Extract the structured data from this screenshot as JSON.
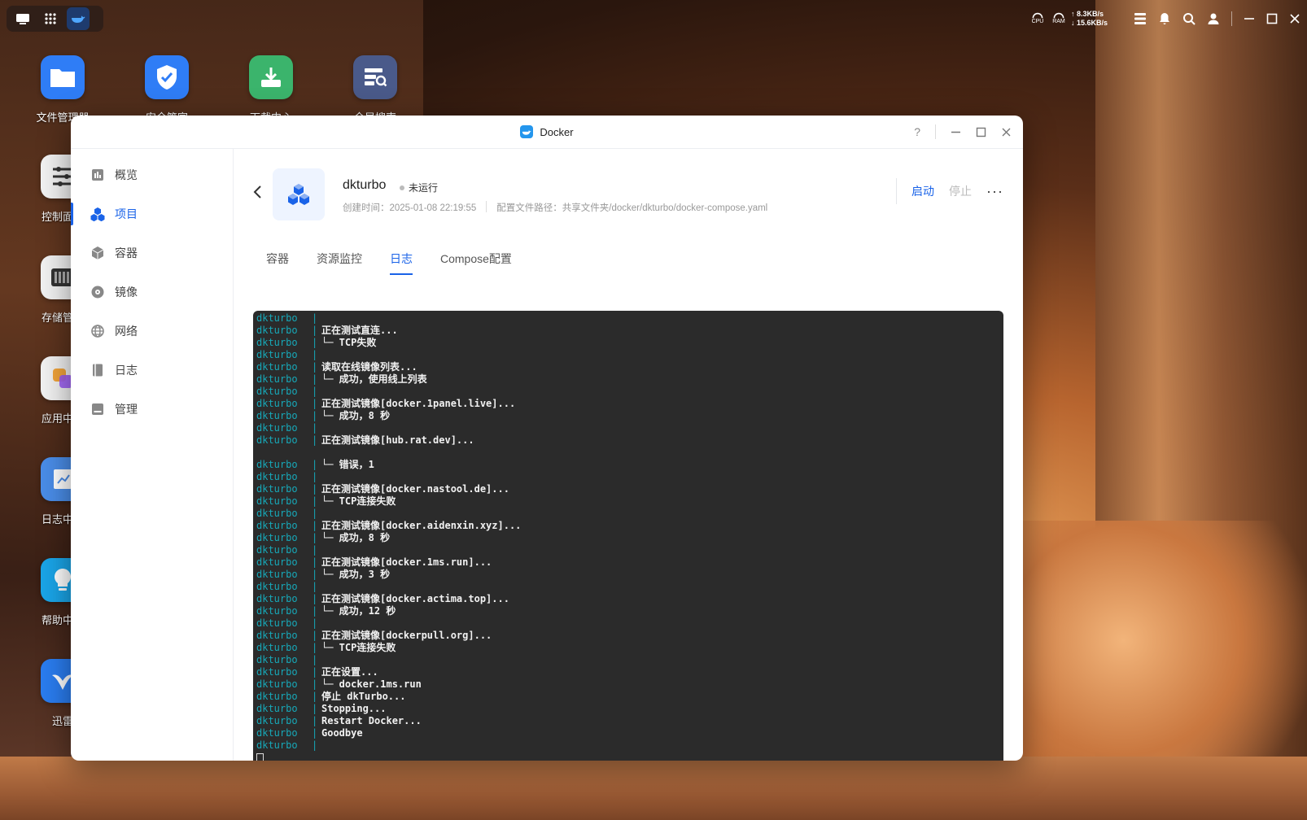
{
  "taskbar": {
    "network": {
      "up": "↑ 8.3KB/s",
      "down": "↓ 15.6KB/s"
    },
    "cpu_label": "CPU",
    "ram_label": "RAM"
  },
  "desktop_icons": [
    {
      "label": "文件管理器",
      "icon": "folder-icon",
      "color": "#2f7df6"
    },
    {
      "label": "安全管家",
      "icon": "shield-icon",
      "color": "#2f7df6"
    },
    {
      "label": "下载中心",
      "icon": "download-icon",
      "color": "#3bb46c"
    },
    {
      "label": "全局搜索",
      "icon": "search-server-icon",
      "color": "#4a5a8a"
    },
    {
      "label": "控制面板",
      "icon": "sliders-icon",
      "color": "#f2f2f2"
    },
    {
      "label": "存储管理",
      "icon": "storage-icon",
      "color": "#f2f2f2"
    },
    {
      "label": "应用中心",
      "icon": "apps-icon",
      "color": "#f2f2f2"
    },
    {
      "label": "日志中心",
      "icon": "log-icon",
      "color": "#4a8de8"
    },
    {
      "label": "帮助中心",
      "icon": "bulb-icon",
      "color": "#1aa5e8"
    },
    {
      "label": "迅雷",
      "icon": "thunder-icon",
      "color": "#2a7df0"
    }
  ],
  "window": {
    "title": "Docker",
    "help": "?"
  },
  "sidebar": {
    "items": [
      {
        "label": "概览",
        "icon": "overview-icon",
        "active": false
      },
      {
        "label": "项目",
        "icon": "project-icon",
        "active": true
      },
      {
        "label": "容器",
        "icon": "container-icon",
        "active": false
      },
      {
        "label": "镜像",
        "icon": "image-icon",
        "active": false
      },
      {
        "label": "网络",
        "icon": "network-icon",
        "active": false
      },
      {
        "label": "日志",
        "icon": "log-icon",
        "active": false
      },
      {
        "label": "管理",
        "icon": "manage-icon",
        "active": false
      }
    ]
  },
  "project": {
    "name": "dkturbo",
    "status": "未运行",
    "created": "创建时间：2025-01-08 22:19:55",
    "config_path": "配置文件路径：共享文件夹/docker/dkturbo/docker-compose.yaml",
    "start_label": "启动",
    "stop_label": "停止",
    "more": "···"
  },
  "tabs": [
    {
      "label": "容器",
      "active": false
    },
    {
      "label": "资源监控",
      "active": false
    },
    {
      "label": "日志",
      "active": true
    },
    {
      "label": "Compose配置",
      "active": false
    }
  ],
  "log": {
    "prefix": "dkturbo",
    "lines": [
      {
        "p": true,
        "t": ""
      },
      {
        "p": true,
        "t": "正在测试直连..."
      },
      {
        "p": true,
        "t": "└─ TCP失败"
      },
      {
        "p": true,
        "t": ""
      },
      {
        "p": true,
        "t": "读取在线镜像列表..."
      },
      {
        "p": true,
        "t": "└─ 成功，使用线上列表"
      },
      {
        "p": true,
        "t": ""
      },
      {
        "p": true,
        "t": "正在测试镜像[docker.1panel.live]..."
      },
      {
        "p": true,
        "t": "└─ 成功，8 秒"
      },
      {
        "p": true,
        "t": ""
      },
      {
        "p": true,
        "t": "正在测试镜像[hub.rat.dev]..."
      },
      {
        "p": false,
        "t": ""
      },
      {
        "p": true,
        "t": "└─ 错误，1"
      },
      {
        "p": true,
        "t": ""
      },
      {
        "p": true,
        "t": "正在测试镜像[docker.nastool.de]..."
      },
      {
        "p": true,
        "t": "└─ TCP连接失败"
      },
      {
        "p": true,
        "t": ""
      },
      {
        "p": true,
        "t": "正在测试镜像[docker.aidenxin.xyz]..."
      },
      {
        "p": true,
        "t": "└─ 成功，8 秒"
      },
      {
        "p": true,
        "t": ""
      },
      {
        "p": true,
        "t": "正在测试镜像[docker.1ms.run]..."
      },
      {
        "p": true,
        "t": "└─ 成功，3 秒"
      },
      {
        "p": true,
        "t": ""
      },
      {
        "p": true,
        "t": "正在测试镜像[docker.actima.top]..."
      },
      {
        "p": true,
        "t": "└─ 成功，12 秒"
      },
      {
        "p": true,
        "t": ""
      },
      {
        "p": true,
        "t": "正在测试镜像[dockerpull.org]..."
      },
      {
        "p": true,
        "t": "└─ TCP连接失败"
      },
      {
        "p": true,
        "t": ""
      },
      {
        "p": true,
        "t": "正在设置..."
      },
      {
        "p": true,
        "t": "└─ docker.1ms.run"
      },
      {
        "p": true,
        "t": "停止 dkTurbo..."
      },
      {
        "p": true,
        "t": "Stopping..."
      },
      {
        "p": true,
        "t": "Restart Docker..."
      },
      {
        "p": true,
        "t": "Goodbye"
      },
      {
        "p": true,
        "t": ""
      }
    ]
  },
  "colors": {
    "accent": "#1a63e8",
    "console_bg": "#2b2b2b",
    "log_prefix": "#17a8b8"
  }
}
